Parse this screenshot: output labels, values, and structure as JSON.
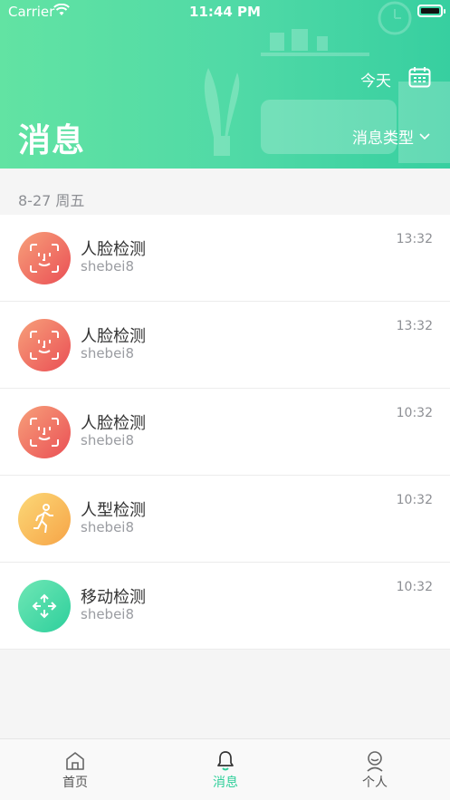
{
  "status_bar": {
    "carrier": "Carrier",
    "time": "11:44 PM"
  },
  "header": {
    "title": "消息",
    "today_label": "今天",
    "filter_label": "消息类型",
    "calendar_icon": "calendar-icon",
    "filter_icon": "chevron-down-icon"
  },
  "date_group": "8-27 周五",
  "messages": [
    {
      "title": "人脸检测",
      "device": "shebei8",
      "time": "13:32",
      "icon": "face-scan-icon"
    },
    {
      "title": "人脸检测",
      "device": "shebei8",
      "time": "13:32",
      "icon": "face-scan-icon"
    },
    {
      "title": "人脸检测",
      "device": "shebei8",
      "time": "10:32",
      "icon": "face-scan-icon"
    },
    {
      "title": "人型检测",
      "device": "shebei8",
      "time": "10:32",
      "icon": "walking-person-icon"
    },
    {
      "title": "移动检测",
      "device": "shebei8",
      "time": "10:32",
      "icon": "move-arrows-icon"
    }
  ],
  "tabbar": {
    "home": "首页",
    "messages": "消息",
    "profile": "个人",
    "active_color": "#2fcf9a"
  },
  "colors": {
    "header_gradient_start": "#62e3a3",
    "header_gradient_end": "#37cfa0",
    "face_gradient": "#ea4f55",
    "person_gradient": "#f6a447",
    "motion_gradient": "#2ecf9c"
  }
}
